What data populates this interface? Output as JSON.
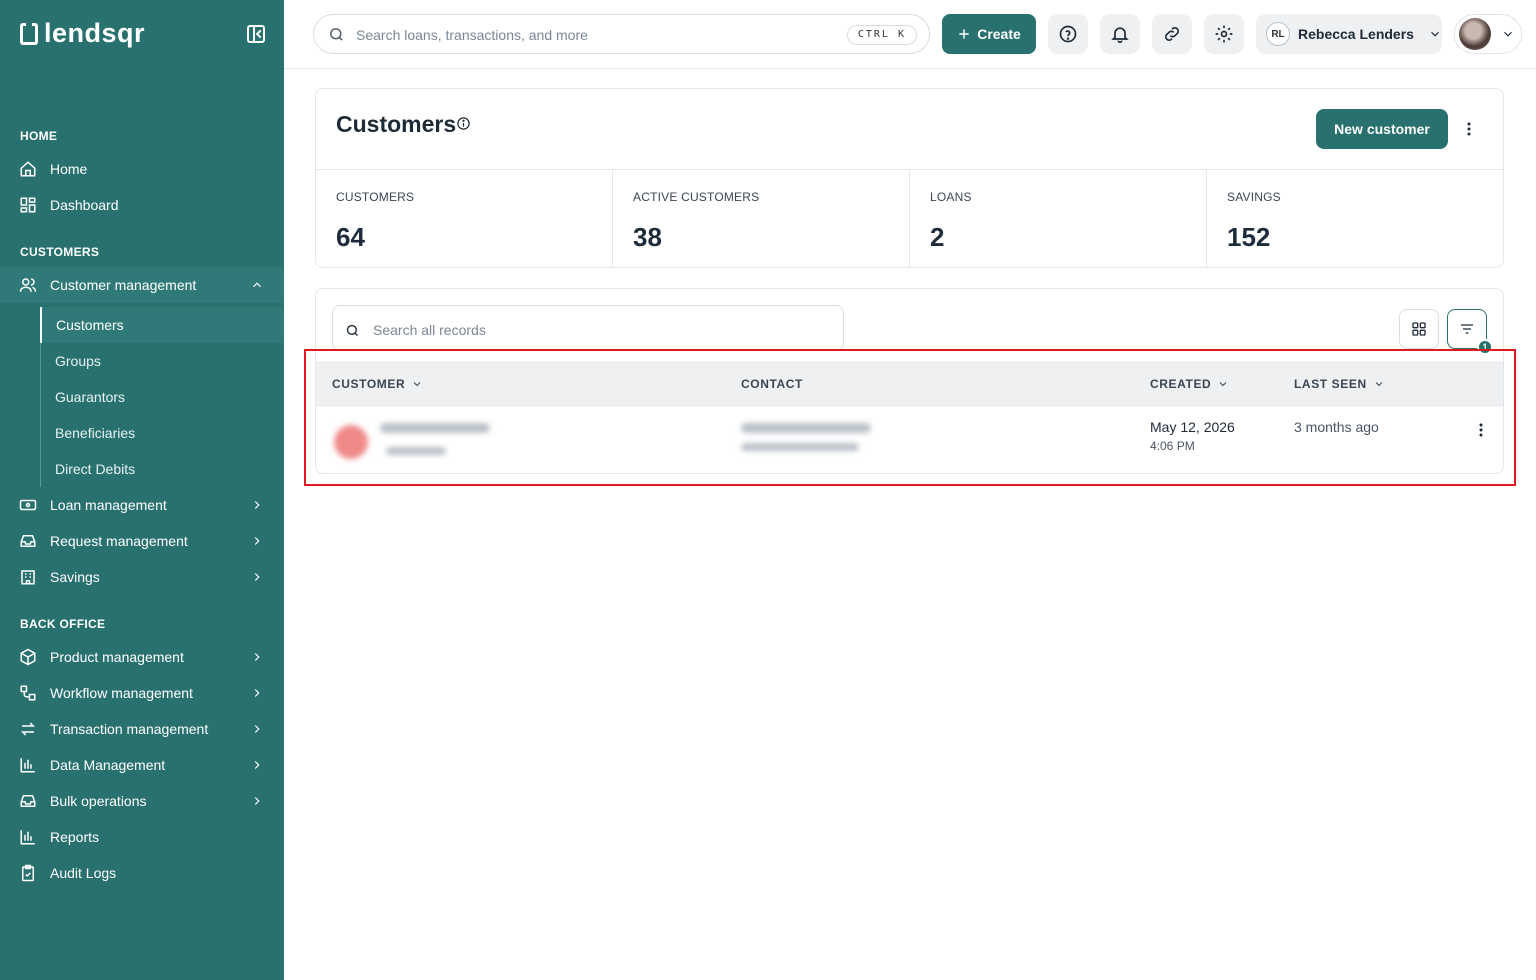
{
  "brand": {
    "name": "lendsqr"
  },
  "sidebar": {
    "sections": {
      "home": "HOME",
      "customers": "CUSTOMERS",
      "back_office": "BACK OFFICE"
    },
    "home_items": [
      {
        "label": "Home",
        "icon": "home-icon"
      },
      {
        "label": "Dashboard",
        "icon": "dashboard-icon"
      }
    ],
    "customer_items": [
      {
        "label": "Customer management",
        "icon": "users-icon",
        "expanded": true
      },
      {
        "label": "Loan management",
        "icon": "loan-icon"
      },
      {
        "label": "Request management",
        "icon": "inbox-icon"
      },
      {
        "label": "Savings",
        "icon": "savings-icon"
      }
    ],
    "customer_sub_items": [
      {
        "label": "Customers",
        "active": true
      },
      {
        "label": "Groups"
      },
      {
        "label": "Guarantors"
      },
      {
        "label": "Beneficiaries"
      },
      {
        "label": "Direct Debits"
      }
    ],
    "back_office_items": [
      {
        "label": "Product management",
        "icon": "box-icon"
      },
      {
        "label": "Workflow management",
        "icon": "workflow-icon"
      },
      {
        "label": "Transaction management",
        "icon": "transfer-icon"
      },
      {
        "label": "Data Management",
        "icon": "bar-chart-icon"
      },
      {
        "label": "Bulk operations",
        "icon": "inbox-icon"
      },
      {
        "label": "Reports",
        "icon": "reports-icon"
      },
      {
        "label": "Audit Logs",
        "icon": "clipboard-icon"
      }
    ]
  },
  "topbar": {
    "search_placeholder": "Search loans, transactions, and more",
    "shortcut": "CTRL K",
    "create_label": "Create",
    "user_initials": "RL",
    "user_name": "Rebecca Lenders"
  },
  "page": {
    "title": "Customers",
    "new_customer_label": "New customer",
    "stats": [
      {
        "label": "CUSTOMERS",
        "value": "64"
      },
      {
        "label": "ACTIVE CUSTOMERS",
        "value": "38"
      },
      {
        "label": "LOANS",
        "value": "2"
      },
      {
        "label": "SAVINGS",
        "value": "152"
      }
    ]
  },
  "records": {
    "search_placeholder": "Search all records",
    "filter_count": "1",
    "columns": {
      "customer": "CUSTOMER",
      "contact": "CONTACT",
      "created": "CREATED",
      "last_seen": "LAST SEEN"
    },
    "rows": [
      {
        "created_date": "May 12, 2026",
        "created_time": "4:06 PM",
        "last_seen": "3 months ago"
      }
    ]
  },
  "colors": {
    "brand": "#28716f",
    "highlight": "#e0191e"
  }
}
